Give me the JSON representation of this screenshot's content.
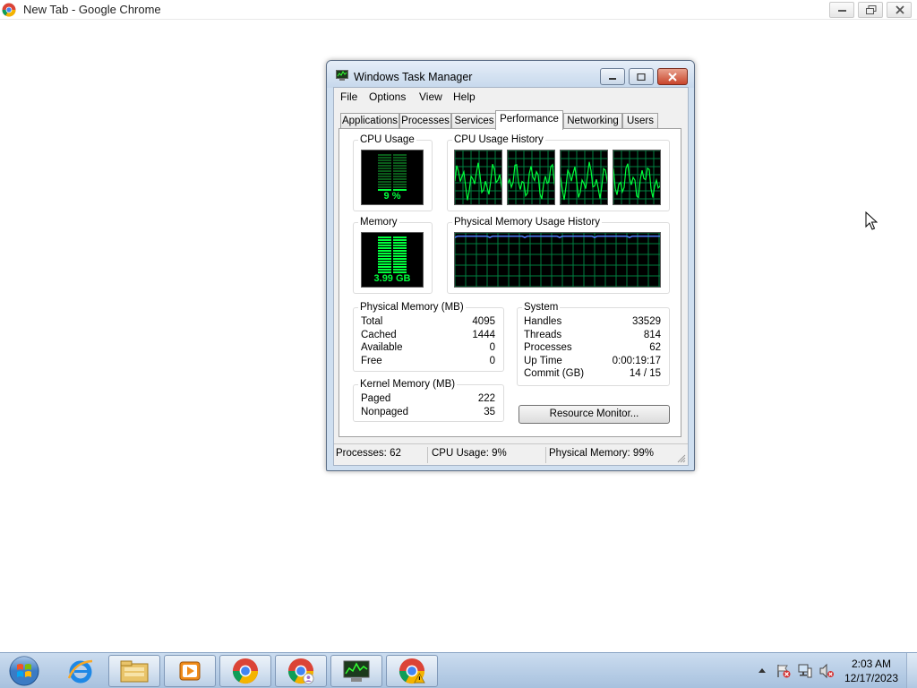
{
  "browser": {
    "title": "New Tab - Google Chrome",
    "icon": "chrome-icon"
  },
  "task_manager": {
    "title": "Windows Task Manager",
    "menu": [
      "File",
      "Options",
      "View",
      "Help"
    ],
    "tabs": [
      "Applications",
      "Processes",
      "Services",
      "Performance",
      "Networking",
      "Users"
    ],
    "active_tab": "Performance",
    "cpu_usage": {
      "label": "CPU Usage",
      "value": "9 %",
      "percent": 9
    },
    "cpu_history": {
      "label": "CPU Usage History",
      "cores": 4
    },
    "memory": {
      "label": "Memory",
      "value": "3.99 GB",
      "percent": 99
    },
    "memory_history": {
      "label": "Physical Memory Usage History"
    },
    "physical_memory": {
      "label": "Physical Memory (MB)",
      "rows": [
        {
          "label": "Total",
          "value": "4095"
        },
        {
          "label": "Cached",
          "value": "1444"
        },
        {
          "label": "Available",
          "value": "0"
        },
        {
          "label": "Free",
          "value": "0"
        }
      ]
    },
    "kernel_memory": {
      "label": "Kernel Memory (MB)",
      "rows": [
        {
          "label": "Paged",
          "value": "222"
        },
        {
          "label": "Nonpaged",
          "value": "35"
        }
      ]
    },
    "system": {
      "label": "System",
      "rows": [
        {
          "label": "Handles",
          "value": "33529"
        },
        {
          "label": "Threads",
          "value": "814"
        },
        {
          "label": "Processes",
          "value": "62"
        },
        {
          "label": "Up Time",
          "value": "0:00:19:17"
        },
        {
          "label": "Commit (GB)",
          "value": "14 / 15"
        }
      ]
    },
    "resource_monitor_button": "Resource Monitor...",
    "status": {
      "processes": "Processes: 62",
      "cpu": "CPU Usage: 9%",
      "memory": "Physical Memory: 99%"
    }
  },
  "taskbar": {
    "pinned": [
      "start-orb-icon",
      "internet-explorer-icon",
      "file-explorer-icon",
      "media-player-icon",
      "chrome-icon",
      "chrome-profile-icon",
      "task-manager-icon",
      "chrome-alert-icon"
    ],
    "clock_time": "2:03 AM",
    "clock_date": "12/17/2023"
  },
  "colors": {
    "graph_green": "#00ff3c",
    "graph_grid": "#008040",
    "memory_line": "#4f7cff",
    "title_bar": "#c6d8ec"
  }
}
